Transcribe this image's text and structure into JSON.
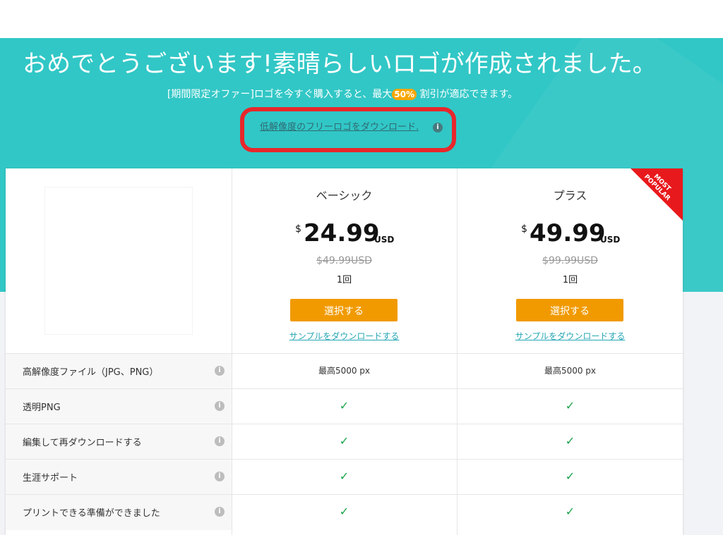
{
  "hero": {
    "title": "おめでとうございます!素晴らしいロゴが作成されました。",
    "offer_before": "[期間限定オファー]ロゴを今すぐ購入すると、最大",
    "offer_percent": "50%",
    "offer_after": "割引が適応できます。",
    "free_download_link": "低解像度のフリーロゴをダウンロード.",
    "info_glyph": "i"
  },
  "plans": [
    {
      "name": "ベーシック",
      "currency_symbol": "$",
      "price": "24.99",
      "currency": "USD",
      "old_price": "$49.99USD",
      "frequency": "1回",
      "select_label": "選択する",
      "sample_link": "サンプルをダウンロードする"
    },
    {
      "name": "プラス",
      "currency_symbol": "$",
      "price": "49.99",
      "currency": "USD",
      "old_price": "$99.99USD",
      "frequency": "1回",
      "select_label": "選択する",
      "sample_link": "サンプルをダウンロードする",
      "ribbon_line1": "MOST",
      "ribbon_line2": "POPULAR"
    }
  ],
  "features": [
    {
      "label": "高解像度ファイル（JPG、PNG）",
      "basic": "最高5000 px",
      "plus": "最高5000 px"
    },
    {
      "label": "透明PNG",
      "basic": "✓",
      "plus": "✓"
    },
    {
      "label": "編集して再ダウンロードする",
      "basic": "✓",
      "plus": "✓"
    },
    {
      "label": "生涯サポート",
      "basic": "✓",
      "plus": "✓"
    },
    {
      "label": "プリントできる準備ができました",
      "basic": "✓",
      "plus": "✓"
    }
  ],
  "icons": {
    "info": "info-icon",
    "check": "checkmark-icon",
    "check_color": "#1aa34a"
  },
  "colors": {
    "hero_bg": "#31c7c6",
    "button_bg": "#f19a00",
    "highlight_border": "#e8272b",
    "ribbon": "#e8191c"
  }
}
